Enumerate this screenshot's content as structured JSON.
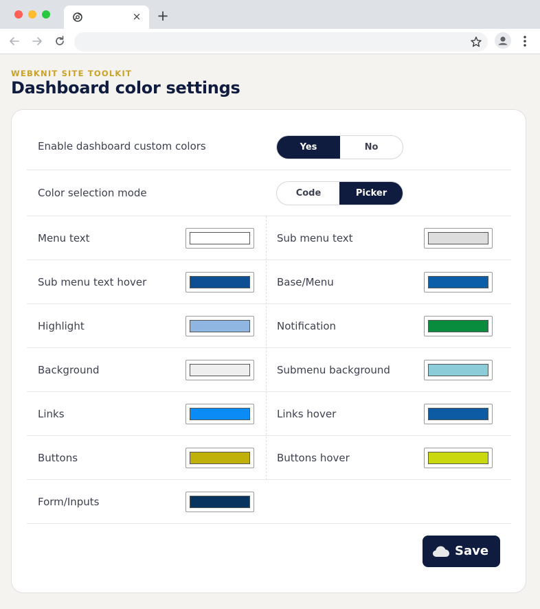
{
  "browser": {
    "tab_close": "×",
    "new_tab": "+"
  },
  "page": {
    "eyebrow": "WEBKNIT SITE TOOLKIT",
    "title": "Dashboard color settings"
  },
  "settings": {
    "enable_custom": {
      "label": "Enable dashboard custom colors",
      "options": [
        "Yes",
        "No"
      ],
      "selected": "Yes"
    },
    "selection_mode": {
      "label": "Color selection mode",
      "options": [
        "Code",
        "Picker"
      ],
      "selected": "Picker"
    }
  },
  "colors": [
    {
      "label": "Menu text",
      "color": "#ffffff"
    },
    {
      "label": "Sub menu text",
      "color": "#dddddd"
    },
    {
      "label": "Sub menu text hover",
      "color": "#0d4f92"
    },
    {
      "label": "Base/Menu",
      "color": "#0c5ea8"
    },
    {
      "label": "Highlight",
      "color": "#8fb6e0"
    },
    {
      "label": "Notification",
      "color": "#0a8c3f"
    },
    {
      "label": "Background",
      "color": "#eeeeee"
    },
    {
      "label": "Submenu background",
      "color": "#8ccbd8"
    },
    {
      "label": "Links",
      "color": "#0a8bf5"
    },
    {
      "label": "Links hover",
      "color": "#0c5ba3"
    },
    {
      "label": "Buttons",
      "color": "#bfb10a"
    },
    {
      "label": "Buttons hover",
      "color": "#cad810"
    },
    {
      "label": "Form/Inputs",
      "color": "#08335e"
    }
  ],
  "actions": {
    "save_label": "Save"
  },
  "theme": {
    "primary": "#0f1c3f",
    "accent": "#c9a227"
  }
}
